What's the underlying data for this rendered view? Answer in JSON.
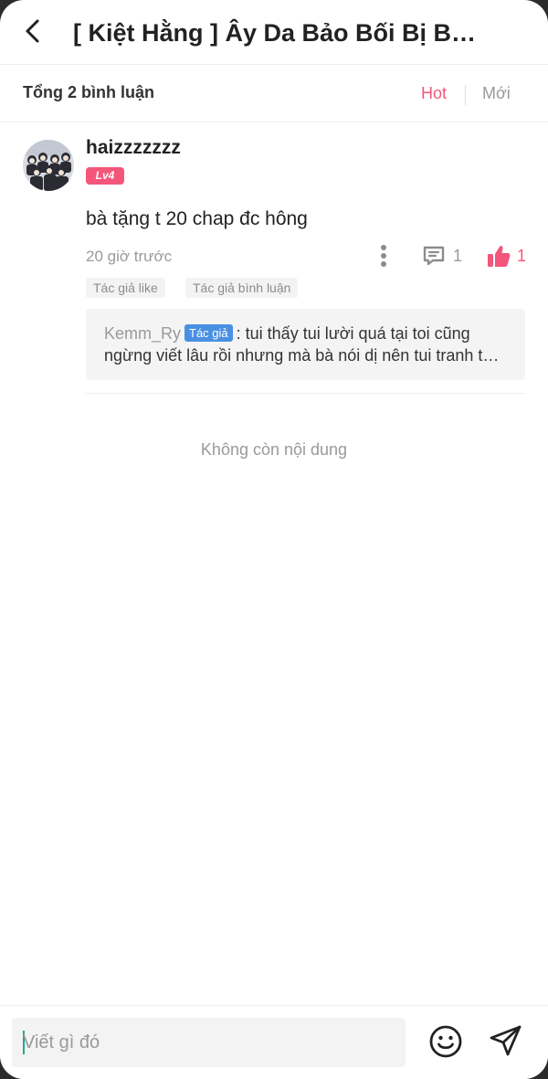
{
  "header": {
    "title": "[ Kiệt Hằng ] Ây Da Bảo Bối Bị Bắt Nạt Rồi"
  },
  "subbar": {
    "total_label": "Tổng 2 bình luận",
    "sort_hot": "Hot",
    "sort_new": "Mới"
  },
  "comment": {
    "username": "haizzzzzzz",
    "level": "Lv4",
    "text": "bà tặng t 20 chap đc hông",
    "time": "20 giờ trước",
    "reply_count": "1",
    "like_count": "1",
    "tags": [
      "Tác giả like",
      "Tác giả bình luận"
    ],
    "reply": {
      "author": "Kemm_Ry",
      "badge": "Tác giả",
      "line1": ": tui thấy tui lười quá tại toi cũng",
      "line2": "ngừng viết lâu rồi nhưng mà bà nói dị nên tui tranh thủ viết"
    }
  },
  "footer_text": "Không còn nội dung",
  "input": {
    "placeholder": "Viết gì đó"
  },
  "colors": {
    "accent": "#f2567a",
    "badge_blue": "#4a90e2",
    "muted": "#9a9a9a"
  },
  "icons": [
    "back-arrow-icon",
    "more-vertical-icon",
    "comment-icon",
    "thumbs-up-icon",
    "emoji-icon",
    "send-icon"
  ]
}
